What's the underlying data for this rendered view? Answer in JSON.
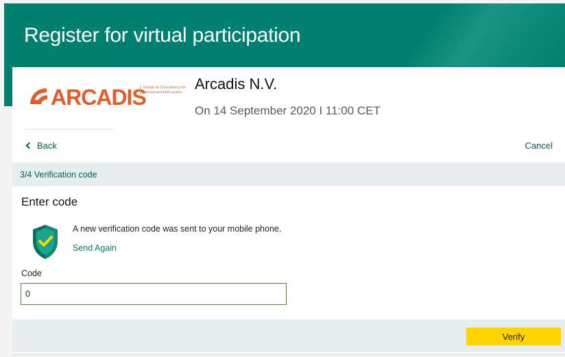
{
  "header": {
    "title": "Register for virtual participation"
  },
  "event": {
    "company": "Arcadis N.V.",
    "date": "On 14 September 2020 I 11:00 CET",
    "logo": {
      "word": "ARCADIS",
      "tagline": "Design & Consultancy for natural and built assets",
      "color": "#e35c2a"
    }
  },
  "nav": {
    "back_label": "Back",
    "cancel_label": "Cancel"
  },
  "step": {
    "label": "3/4 Verification code"
  },
  "form": {
    "title": "Enter code",
    "message": "A new verification code was sent to your mobile phone.",
    "send_again_label": "Send Again",
    "code_label": "Code",
    "code_value": "0",
    "verify_label": "Verify"
  },
  "icons": {
    "shield": "shield-check-icon",
    "back": "chevron-left-icon",
    "logo": "arcadis-logo"
  },
  "colors": {
    "primary": "#008070",
    "link": "#005f54",
    "accent_button": "#ffd500",
    "step_bar": "#e7efee"
  }
}
